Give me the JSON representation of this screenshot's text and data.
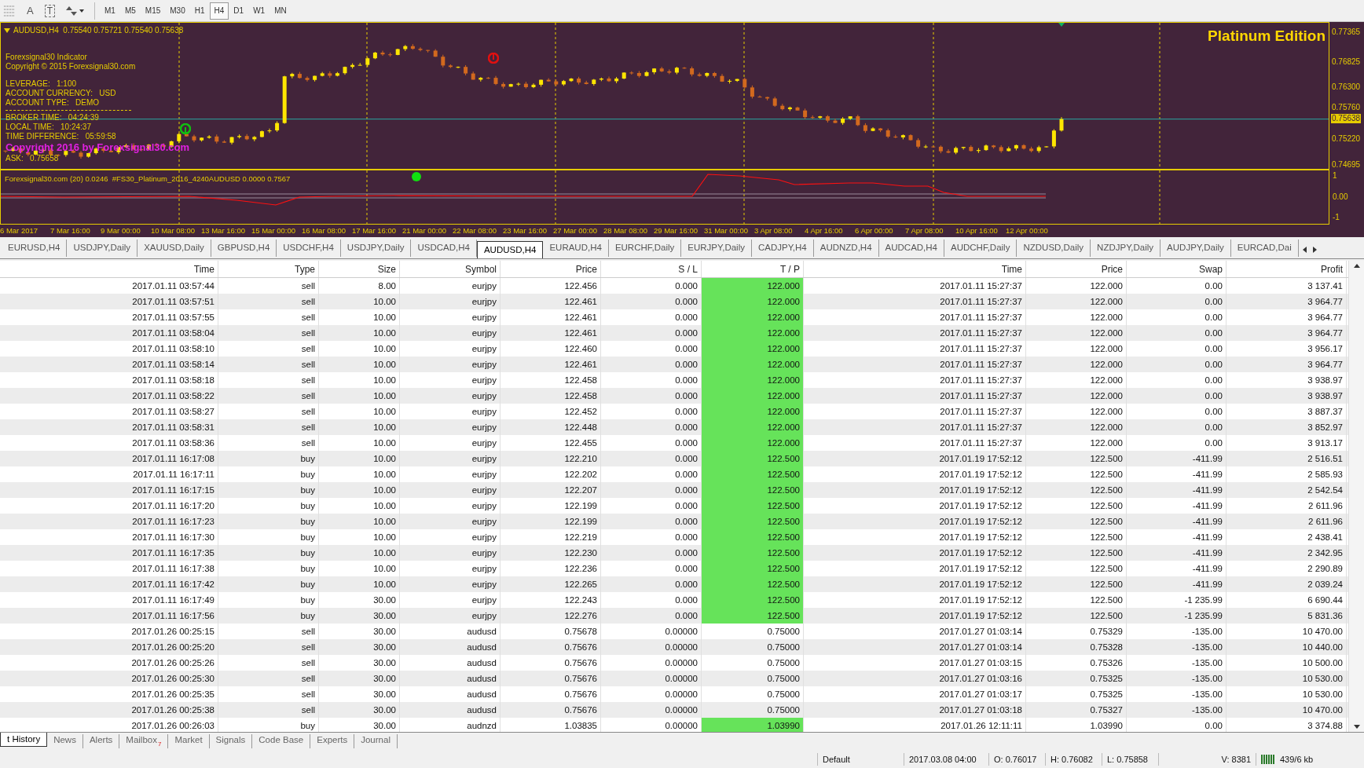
{
  "toolbar": {
    "tools": [
      {
        "kind": "grid"
      },
      {
        "kind": "text",
        "label": "A"
      },
      {
        "kind": "label",
        "label": "T"
      },
      {
        "kind": "arrows"
      }
    ],
    "timeframes": [
      {
        "label": "M1",
        "selected": false
      },
      {
        "label": "M5",
        "selected": false
      },
      {
        "label": "M15",
        "selected": false
      },
      {
        "label": "M30",
        "selected": false
      },
      {
        "label": "H1",
        "selected": false
      },
      {
        "label": "H4",
        "selected": true
      },
      {
        "label": "D1",
        "selected": false
      },
      {
        "label": "W1",
        "selected": false
      },
      {
        "label": "MN",
        "selected": false
      }
    ]
  },
  "chart": {
    "header": "AUDUSD,H4  0.75540 0.75721 0.75540 0.75638",
    "edition": "Platinum Edition",
    "info_lines": [
      {
        "kind": "plain",
        "text": "Forexsignal30 Indicator"
      },
      {
        "kind": "plain",
        "text": "Copyright © 2015 Forexsignal30.com"
      },
      {
        "kind": "gap"
      },
      {
        "kind": "plain",
        "text": "LEVERAGE:   1:100"
      },
      {
        "kind": "plain",
        "text": "ACCOUNT CURRENCY:   USD"
      },
      {
        "kind": "plain",
        "text": "ACCOUNT TYPE:   DEMO"
      },
      {
        "kind": "rule"
      },
      {
        "kind": "plain",
        "text": "BROKER TIME:   04:24:39"
      },
      {
        "kind": "plain",
        "text": "LOCAL TIME:   10:24:37"
      },
      {
        "kind": "plain",
        "text": "TIME DIFFERENCE:   05:59:58"
      },
      {
        "kind": "banner",
        "text": "Copyright 2016 by Forexsignal30.com"
      },
      {
        "kind": "plain",
        "text": "ASK:   0.75658"
      }
    ],
    "price_axis": [
      {
        "label": "0.77365",
        "current": false
      },
      {
        "label": "0.76825",
        "current": false
      },
      {
        "label": "0.76300",
        "current": false
      },
      {
        "label": "0.75760",
        "current": false
      },
      {
        "label": "0.75638",
        "current": true
      },
      {
        "label": "0.75220",
        "current": false
      },
      {
        "label": "0.74695",
        "current": false
      }
    ],
    "indicator": {
      "header": "Forexsignal30.com (20) 0.0246  #FS30_Platinum_2016_4240AUDUSD 0.0000 0.7567",
      "axis": [
        "1",
        "0.00",
        "-1"
      ]
    },
    "time_axis": [
      "6 Mar 2017",
      "7 Mar 16:00",
      "9 Mar 00:00",
      "10 Mar 08:00",
      "13 Mar 16:00",
      "15 Mar 00:00",
      "16 Mar 08:00",
      "17 Mar 16:00",
      "21 Mar 00:00",
      "22 Mar 08:00",
      "23 Mar 16:00",
      "27 Mar 00:00",
      "28 Mar 08:00",
      "29 Mar 16:00",
      "31 Mar 00:00",
      "3 Apr 08:00",
      "4 Apr 16:00",
      "6 Apr 00:00",
      "7 Apr 08:00",
      "10 Apr 16:00",
      "12 Apr 00:00"
    ]
  },
  "chart_tabs": [
    {
      "label": "EURUSD,H4",
      "selected": false
    },
    {
      "label": "USDJPY,Daily",
      "selected": false
    },
    {
      "label": "XAUUSD,Daily",
      "selected": false
    },
    {
      "label": "GBPUSD,H4",
      "selected": false
    },
    {
      "label": "USDCHF,H4",
      "selected": false
    },
    {
      "label": "USDJPY,Daily",
      "selected": false
    },
    {
      "label": "USDCAD,H4",
      "selected": false
    },
    {
      "label": "AUDUSD,H4",
      "selected": true
    },
    {
      "label": "EURAUD,H4",
      "selected": false
    },
    {
      "label": "EURCHF,Daily",
      "selected": false
    },
    {
      "label": "EURJPY,Daily",
      "selected": false
    },
    {
      "label": "CADJPY,H4",
      "selected": false
    },
    {
      "label": "AUDNZD,H4",
      "selected": false
    },
    {
      "label": "AUDCAD,H4",
      "selected": false
    },
    {
      "label": "AUDCHF,Daily",
      "selected": false
    },
    {
      "label": "NZDUSD,Daily",
      "selected": false
    },
    {
      "label": "NZDJPY,Daily",
      "selected": false
    },
    {
      "label": "AUDJPY,Daily",
      "selected": false
    },
    {
      "label": "EURCAD,Dai",
      "selected": false
    }
  ],
  "table": {
    "columns": [
      "Time",
      "Type",
      "Size",
      "Symbol",
      "Price",
      "S / L",
      "T / P",
      "Time",
      "Price",
      "Swap",
      "Profit"
    ],
    "rows": [
      {
        "cells": [
          "2017.01.11 03:57:44",
          "sell",
          "8.00",
          "eurjpy",
          "122.456",
          "0.000",
          "122.000",
          "2017.01.11 15:27:37",
          "122.000",
          "0.00",
          "3 137.41"
        ],
        "tp_hit": true
      },
      {
        "cells": [
          "2017.01.11 03:57:51",
          "sell",
          "10.00",
          "eurjpy",
          "122.461",
          "0.000",
          "122.000",
          "2017.01.11 15:27:37",
          "122.000",
          "0.00",
          "3 964.77"
        ],
        "tp_hit": true
      },
      {
        "cells": [
          "2017.01.11 03:57:55",
          "sell",
          "10.00",
          "eurjpy",
          "122.461",
          "0.000",
          "122.000",
          "2017.01.11 15:27:37",
          "122.000",
          "0.00",
          "3 964.77"
        ],
        "tp_hit": true
      },
      {
        "cells": [
          "2017.01.11 03:58:04",
          "sell",
          "10.00",
          "eurjpy",
          "122.461",
          "0.000",
          "122.000",
          "2017.01.11 15:27:37",
          "122.000",
          "0.00",
          "3 964.77"
        ],
        "tp_hit": true
      },
      {
        "cells": [
          "2017.01.11 03:58:10",
          "sell",
          "10.00",
          "eurjpy",
          "122.460",
          "0.000",
          "122.000",
          "2017.01.11 15:27:37",
          "122.000",
          "0.00",
          "3 956.17"
        ],
        "tp_hit": true
      },
      {
        "cells": [
          "2017.01.11 03:58:14",
          "sell",
          "10.00",
          "eurjpy",
          "122.461",
          "0.000",
          "122.000",
          "2017.01.11 15:27:37",
          "122.000",
          "0.00",
          "3 964.77"
        ],
        "tp_hit": true
      },
      {
        "cells": [
          "2017.01.11 03:58:18",
          "sell",
          "10.00",
          "eurjpy",
          "122.458",
          "0.000",
          "122.000",
          "2017.01.11 15:27:37",
          "122.000",
          "0.00",
          "3 938.97"
        ],
        "tp_hit": true
      },
      {
        "cells": [
          "2017.01.11 03:58:22",
          "sell",
          "10.00",
          "eurjpy",
          "122.458",
          "0.000",
          "122.000",
          "2017.01.11 15:27:37",
          "122.000",
          "0.00",
          "3 938.97"
        ],
        "tp_hit": true
      },
      {
        "cells": [
          "2017.01.11 03:58:27",
          "sell",
          "10.00",
          "eurjpy",
          "122.452",
          "0.000",
          "122.000",
          "2017.01.11 15:27:37",
          "122.000",
          "0.00",
          "3 887.37"
        ],
        "tp_hit": true
      },
      {
        "cells": [
          "2017.01.11 03:58:31",
          "sell",
          "10.00",
          "eurjpy",
          "122.448",
          "0.000",
          "122.000",
          "2017.01.11 15:27:37",
          "122.000",
          "0.00",
          "3 852.97"
        ],
        "tp_hit": true
      },
      {
        "cells": [
          "2017.01.11 03:58:36",
          "sell",
          "10.00",
          "eurjpy",
          "122.455",
          "0.000",
          "122.000",
          "2017.01.11 15:27:37",
          "122.000",
          "0.00",
          "3 913.17"
        ],
        "tp_hit": true
      },
      {
        "cells": [
          "2017.01.11 16:17:08",
          "buy",
          "10.00",
          "eurjpy",
          "122.210",
          "0.000",
          "122.500",
          "2017.01.19 17:52:12",
          "122.500",
          "-411.99",
          "2 516.51"
        ],
        "tp_hit": true
      },
      {
        "cells": [
          "2017.01.11 16:17:11",
          "buy",
          "10.00",
          "eurjpy",
          "122.202",
          "0.000",
          "122.500",
          "2017.01.19 17:52:12",
          "122.500",
          "-411.99",
          "2 585.93"
        ],
        "tp_hit": true
      },
      {
        "cells": [
          "2017.01.11 16:17:15",
          "buy",
          "10.00",
          "eurjpy",
          "122.207",
          "0.000",
          "122.500",
          "2017.01.19 17:52:12",
          "122.500",
          "-411.99",
          "2 542.54"
        ],
        "tp_hit": true
      },
      {
        "cells": [
          "2017.01.11 16:17:20",
          "buy",
          "10.00",
          "eurjpy",
          "122.199",
          "0.000",
          "122.500",
          "2017.01.19 17:52:12",
          "122.500",
          "-411.99",
          "2 611.96"
        ],
        "tp_hit": true
      },
      {
        "cells": [
          "2017.01.11 16:17:23",
          "buy",
          "10.00",
          "eurjpy",
          "122.199",
          "0.000",
          "122.500",
          "2017.01.19 17:52:12",
          "122.500",
          "-411.99",
          "2 611.96"
        ],
        "tp_hit": true
      },
      {
        "cells": [
          "2017.01.11 16:17:30",
          "buy",
          "10.00",
          "eurjpy",
          "122.219",
          "0.000",
          "122.500",
          "2017.01.19 17:52:12",
          "122.500",
          "-411.99",
          "2 438.41"
        ],
        "tp_hit": true
      },
      {
        "cells": [
          "2017.01.11 16:17:35",
          "buy",
          "10.00",
          "eurjpy",
          "122.230",
          "0.000",
          "122.500",
          "2017.01.19 17:52:12",
          "122.500",
          "-411.99",
          "2 342.95"
        ],
        "tp_hit": true
      },
      {
        "cells": [
          "2017.01.11 16:17:38",
          "buy",
          "10.00",
          "eurjpy",
          "122.236",
          "0.000",
          "122.500",
          "2017.01.19 17:52:12",
          "122.500",
          "-411.99",
          "2 290.89"
        ],
        "tp_hit": true
      },
      {
        "cells": [
          "2017.01.11 16:17:42",
          "buy",
          "10.00",
          "eurjpy",
          "122.265",
          "0.000",
          "122.500",
          "2017.01.19 17:52:12",
          "122.500",
          "-411.99",
          "2 039.24"
        ],
        "tp_hit": true
      },
      {
        "cells": [
          "2017.01.11 16:17:49",
          "buy",
          "30.00",
          "eurjpy",
          "122.243",
          "0.000",
          "122.500",
          "2017.01.19 17:52:12",
          "122.500",
          "-1 235.99",
          "6 690.44"
        ],
        "tp_hit": true
      },
      {
        "cells": [
          "2017.01.11 16:17:56",
          "buy",
          "30.00",
          "eurjpy",
          "122.276",
          "0.000",
          "122.500",
          "2017.01.19 17:52:12",
          "122.500",
          "-1 235.99",
          "5 831.36"
        ],
        "tp_hit": true
      },
      {
        "cells": [
          "2017.01.26 00:25:15",
          "sell",
          "30.00",
          "audusd",
          "0.75678",
          "0.00000",
          "0.75000",
          "2017.01.27 01:03:14",
          "0.75329",
          "-135.00",
          "10 470.00"
        ],
        "tp_hit": false
      },
      {
        "cells": [
          "2017.01.26 00:25:20",
          "sell",
          "30.00",
          "audusd",
          "0.75676",
          "0.00000",
          "0.75000",
          "2017.01.27 01:03:14",
          "0.75328",
          "-135.00",
          "10 440.00"
        ],
        "tp_hit": false
      },
      {
        "cells": [
          "2017.01.26 00:25:26",
          "sell",
          "30.00",
          "audusd",
          "0.75676",
          "0.00000",
          "0.75000",
          "2017.01.27 01:03:15",
          "0.75326",
          "-135.00",
          "10 500.00"
        ],
        "tp_hit": false
      },
      {
        "cells": [
          "2017.01.26 00:25:30",
          "sell",
          "30.00",
          "audusd",
          "0.75676",
          "0.00000",
          "0.75000",
          "2017.01.27 01:03:16",
          "0.75325",
          "-135.00",
          "10 530.00"
        ],
        "tp_hit": false
      },
      {
        "cells": [
          "2017.01.26 00:25:35",
          "sell",
          "30.00",
          "audusd",
          "0.75676",
          "0.00000",
          "0.75000",
          "2017.01.27 01:03:17",
          "0.75325",
          "-135.00",
          "10 530.00"
        ],
        "tp_hit": false
      },
      {
        "cells": [
          "2017.01.26 00:25:38",
          "sell",
          "30.00",
          "audusd",
          "0.75676",
          "0.00000",
          "0.75000",
          "2017.01.27 01:03:18",
          "0.75327",
          "-135.00",
          "10 470.00"
        ],
        "tp_hit": false
      },
      {
        "cells": [
          "2017.01.26 00:26:03",
          "buy",
          "30.00",
          "audnzd",
          "1.03835",
          "0.00000",
          "1.03990",
          "2017.01.26 12:11:11",
          "1.03990",
          "0.00",
          "3 374.88"
        ],
        "tp_hit": true
      }
    ]
  },
  "bottom_tabs": [
    {
      "label": "t History",
      "selected": true
    },
    {
      "label": "News",
      "selected": false
    },
    {
      "label": "Alerts",
      "selected": false
    },
    {
      "label": "Mailbox",
      "badge": "7",
      "selected": false
    },
    {
      "label": "Market",
      "selected": false
    },
    {
      "label": "Signals",
      "selected": false
    },
    {
      "label": "Code Base",
      "selected": false
    },
    {
      "label": "Experts",
      "selected": false
    },
    {
      "label": "Journal",
      "selected": false
    }
  ],
  "status_bar": {
    "profile": "Default",
    "datetime": "2017.03.08 04:00",
    "open": "O: 0.76017",
    "high": "H: 0.76082",
    "low": "L: 0.75858",
    "volume": "V: 8381",
    "traffic": "439/6 kb"
  }
}
